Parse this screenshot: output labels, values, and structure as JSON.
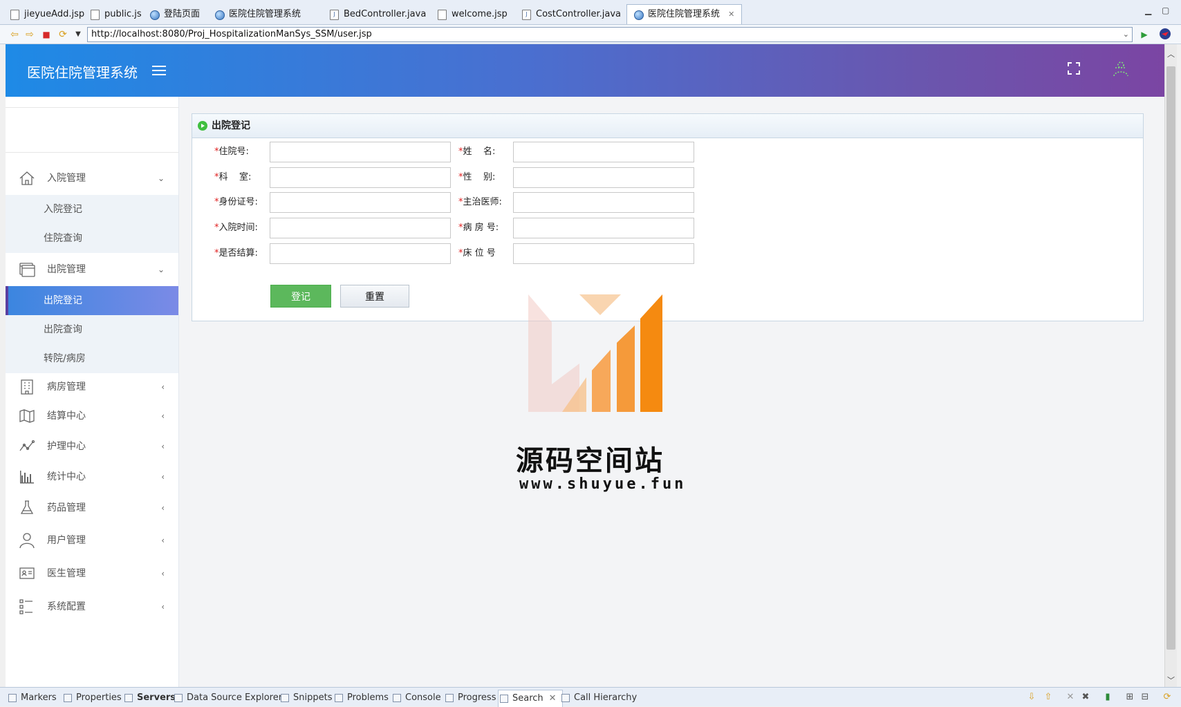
{
  "ide_tabs": [
    {
      "label": "jieyueAdd.jsp",
      "icon": "jsp-file-icon"
    },
    {
      "label": "public.js",
      "icon": "js-file-icon"
    },
    {
      "label": "登陆页面",
      "icon": "browser-globe-icon"
    },
    {
      "label": "医院住院管理系统",
      "icon": "browser-globe-icon"
    },
    {
      "label": "BedController.java",
      "icon": "java-file-icon"
    },
    {
      "label": "welcome.jsp",
      "icon": "jsp-file-icon"
    },
    {
      "label": "CostController.java",
      "icon": "java-file-icon"
    },
    {
      "label": "医院住院管理系统",
      "icon": "browser-globe-icon",
      "active": true
    }
  ],
  "browser": {
    "url": "http://localhost:8080/Proj_HospitalizationManSys_SSM/user.jsp"
  },
  "header": {
    "title": "医院住院管理系统",
    "gradient_start": "#1e8ae6",
    "gradient_end": "#7b45a3"
  },
  "sidebar": {
    "groups": [
      {
        "label": "入院管理",
        "icon": "home-icon",
        "expanded": true,
        "items": [
          "入院登记",
          "住院查询"
        ]
      },
      {
        "label": "出院管理",
        "icon": "window-icon",
        "expanded": true,
        "items": [
          "出院登记",
          "出院查询",
          "转院/病房"
        ],
        "active_item": "出院登记"
      },
      {
        "label": "病房管理",
        "icon": "building-icon"
      },
      {
        "label": "结算中心",
        "icon": "map-icon"
      },
      {
        "label": "护理中心",
        "icon": "line-chart-icon"
      },
      {
        "label": "统计中心",
        "icon": "bar-chart-icon"
      },
      {
        "label": "药品管理",
        "icon": "flask-icon"
      },
      {
        "label": "用户管理",
        "icon": "user-icon"
      },
      {
        "label": "医生管理",
        "icon": "id-card-icon"
      },
      {
        "label": "系统配置",
        "icon": "list-icon"
      }
    ]
  },
  "panel": {
    "title": "出院登记",
    "fields": [
      {
        "label": "住院号:",
        "value": ""
      },
      {
        "label": "姓    名:",
        "value": ""
      },
      {
        "label": "科    室:",
        "value": ""
      },
      {
        "label": "性    别:",
        "value": ""
      },
      {
        "label": "身份证号:",
        "value": ""
      },
      {
        "label": "主治医师:",
        "value": ""
      },
      {
        "label": "入院时间:",
        "value": ""
      },
      {
        "label": "病 房 号:",
        "value": ""
      },
      {
        "label": "是否结算:",
        "value": ""
      },
      {
        "label": "床 位 号",
        "value": ""
      }
    ],
    "required_mark": "*",
    "submit_label": "登记",
    "reset_label": "重置"
  },
  "watermark": {
    "title": "源码空间站",
    "url": "www.shuyue.fun"
  },
  "bottom_views": [
    {
      "label": "Markers"
    },
    {
      "label": "Properties"
    },
    {
      "label": "Servers",
      "bold": true
    },
    {
      "label": "Data Source Explorer"
    },
    {
      "label": "Snippets"
    },
    {
      "label": "Problems"
    },
    {
      "label": "Console"
    },
    {
      "label": "Progress"
    },
    {
      "label": "Search",
      "active": true
    },
    {
      "label": "Call Hierarchy"
    }
  ],
  "colors": {
    "submit_green": "#5cb85c",
    "active_menu": "#3b86e0",
    "required": "#e02020"
  }
}
